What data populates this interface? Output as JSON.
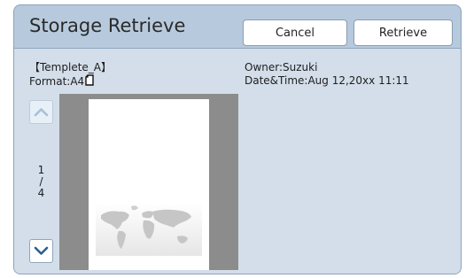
{
  "dialog": {
    "title": "Storage Retrieve",
    "cancel_label": "Cancel",
    "retrieve_label": "Retrieve"
  },
  "details": {
    "template_name": "【Templete_A】",
    "format": "Format:A4",
    "owner": "Owner:Suzuki",
    "date_time": "Date&Time:Aug 12,20xx 11:11"
  },
  "pager": {
    "current": "1",
    "separator": "/",
    "total": "4"
  },
  "icons": {
    "up": "chevron-up-icon",
    "down": "chevron-down-icon",
    "orientation": "portrait-page-icon",
    "preview_art": "world-map-image"
  },
  "colors": {
    "dialog_bg": "#b7cadd",
    "body_bg": "#d3deea",
    "chevron": "#2b5f8c",
    "preview_bg": "#8c8c8c"
  }
}
